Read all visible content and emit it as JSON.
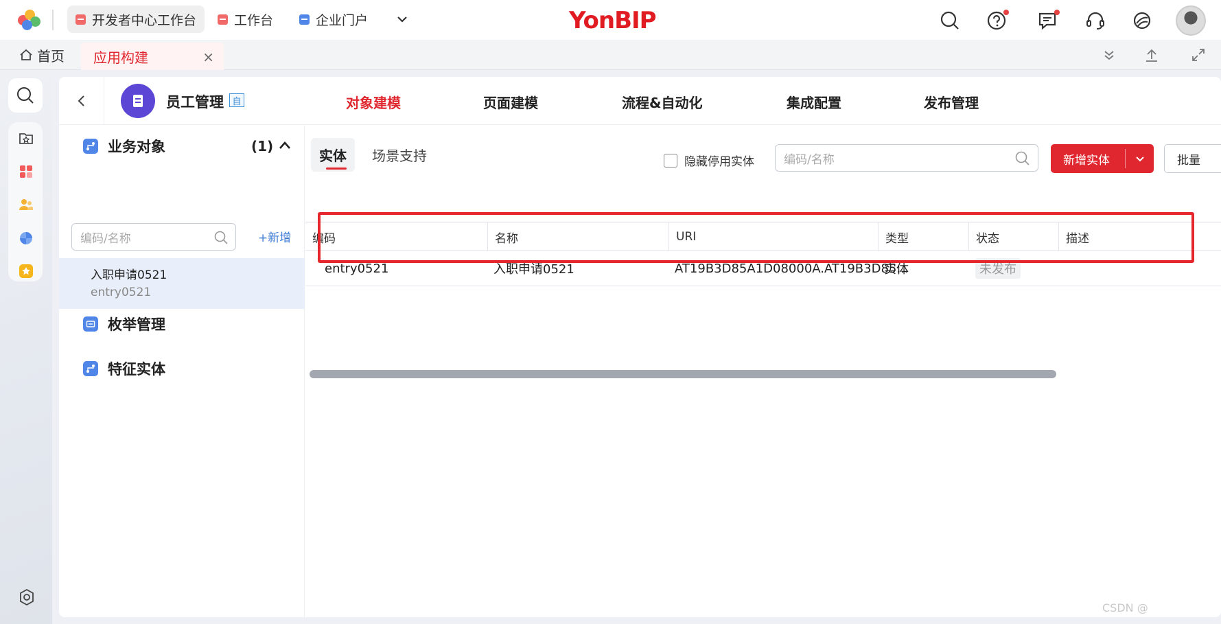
{
  "topbar": {
    "tabs": [
      {
        "label": "开发者中心工作台",
        "color": "#f06a6a"
      },
      {
        "label": "工作台",
        "color": "#f06a6a"
      },
      {
        "label": "企业门户",
        "color": "#4f86e8"
      }
    ],
    "brand": "YonBIP",
    "brand_color": "#e11b22"
  },
  "tabstrip": {
    "home_label": "首页",
    "active_tab_label": "应用构建",
    "close_glyph": "×"
  },
  "app": {
    "name": "员工管理",
    "badge": "自",
    "nav_tabs": [
      "对象建模",
      "页面建模",
      "流程&自动化",
      "集成配置",
      "发布管理"
    ],
    "active_nav": "对象建模"
  },
  "tree": {
    "groups": [
      {
        "label": "业务对象",
        "count": "(1)"
      },
      {
        "label": "枚举管理"
      },
      {
        "label": "特征实体"
      }
    ],
    "search_placeholder": "编码/名称",
    "add_label": "新增",
    "add_glyph": "+",
    "selected_item": {
      "name": "入职申请0521",
      "code": "entry0521"
    }
  },
  "content": {
    "sub_tabs": [
      "实体",
      "场景支持"
    ],
    "hide_disabled_label": "隐藏停用实体",
    "search_placeholder": "编码/名称",
    "new_entity_label": "新增实体",
    "batch_label": "批量",
    "columns": [
      "编码",
      "名称",
      "URI",
      "类型",
      "状态",
      "描述"
    ],
    "rows": [
      {
        "code": "entry0521",
        "name": "入职申请0521",
        "uri": "AT19B3D85A1D08000A.AT19B3D85...",
        "type": "实体",
        "status": "未发布",
        "desc": ""
      }
    ]
  },
  "accent_color": "#e0272f",
  "watermark": "CSDN @"
}
